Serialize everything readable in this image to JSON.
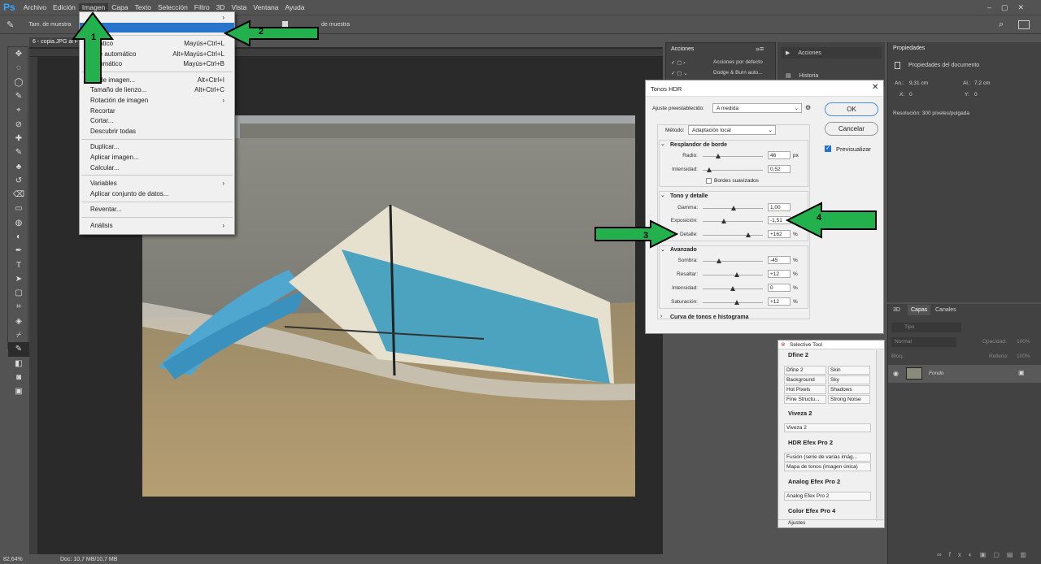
{
  "app": {
    "logo": "Ps"
  },
  "menubar": [
    "Archivo",
    "Edición",
    "Imagen",
    "Capa",
    "Texto",
    "Selección",
    "Filtro",
    "3D",
    "Vista",
    "Ventana",
    "Ayuda"
  ],
  "options": {
    "sample_size": "Tam. de muestra",
    "sample_label": "de muestra"
  },
  "doc": {
    "tab": "6 - copia.JPG al F",
    "zoom": "82,64%",
    "doc_size": "Doc: 10,7 MB/10,7 MB"
  },
  "image_menu": {
    "items": [
      {
        "label": "o",
        "shortcut": "",
        "sub": true,
        "state": "normal"
      },
      {
        "label": "",
        "shortcut": "",
        "sub": false,
        "state": "hl"
      },
      {
        "sep": true
      },
      {
        "label": "omático",
        "shortcut": "Mayús+Ctrl+L",
        "state": "normal"
      },
      {
        "label": "aste automático",
        "shortcut": "Alt+Mayús+Ctrl+L",
        "state": "normal"
      },
      {
        "label": "automático",
        "shortcut": "Mayús+Ctrl+B",
        "state": "normal"
      },
      {
        "sep": true
      },
      {
        "label": "ño de imagen...",
        "shortcut": "Alt+Ctrl+I",
        "state": "normal"
      },
      {
        "label": "Tamaño de lienzo...",
        "shortcut": "Alt+Ctrl+C",
        "state": "normal"
      },
      {
        "label": "Rotación de imagen",
        "shortcut": "",
        "sub": true,
        "state": "normal"
      },
      {
        "label": "Recortar",
        "shortcut": "",
        "state": "normal"
      },
      {
        "label": "Cortar...",
        "shortcut": "",
        "state": "normal"
      },
      {
        "label": "Descubrir todas",
        "shortcut": "",
        "state": "normal"
      },
      {
        "sep": true
      },
      {
        "label": "Duplicar...",
        "shortcut": "",
        "state": "normal"
      },
      {
        "label": "Aplicar imagen...",
        "shortcut": "",
        "state": "normal"
      },
      {
        "label": "Calcular...",
        "shortcut": "",
        "state": "normal"
      },
      {
        "sep": true
      },
      {
        "label": "Variables",
        "shortcut": "",
        "sub": true,
        "state": "normal"
      },
      {
        "label": "Aplicar conjunto de datos...",
        "shortcut": "",
        "state": "normal"
      },
      {
        "sep": true
      },
      {
        "label": "Reventar...",
        "shortcut": "",
        "state": "normal"
      },
      {
        "sep": true
      },
      {
        "label": "Análisis",
        "shortcut": "",
        "sub": true,
        "state": "normal"
      }
    ]
  },
  "actions": {
    "title": "Acciones",
    "rows": [
      "Acciones por defecto",
      "Dodge & Burn auto..."
    ]
  },
  "side": {
    "actions": "Acciones",
    "history": "Historia"
  },
  "props": {
    "title": "Propiedades",
    "doc_props": "Propiedades del documento",
    "an_label": "An.:",
    "an_val": "9,31 cm",
    "al_label": "Al.:",
    "al_val": "7,2 cm",
    "x_label": "X:",
    "x_val": "0",
    "y_label": "Y:",
    "y_val": "0",
    "resolution": "Resolución: 300 píxeles/pulgada"
  },
  "layers": {
    "tabs": [
      "3D",
      "Capas",
      "Canales"
    ],
    "search": "Tipo",
    "blend": "Normal",
    "opacity_label": "Opacidad:",
    "opacity": "100%",
    "lock_label": "Bloq.:",
    "fill_label": "Relleno:",
    "fill": "100%",
    "layer_name": "Fondo"
  },
  "hdr": {
    "title": "Tonos HDR",
    "preset_label": "Ajuste preestablecido:",
    "preset": "A medida",
    "method_label": "Método:",
    "method": "Adaptación local",
    "ok": "OK",
    "cancel": "Cancelar",
    "preview": "Previsualizar",
    "edge_title": "Resplandor de borde",
    "radius_label": "Radio:",
    "radius": "46",
    "radius_unit": "px",
    "strength_label": "Intensidad:",
    "strength": "0,52",
    "smooth": "Bordes suavizados",
    "tone_title": "Tono y detalle",
    "gamma_label": "Gamma:",
    "gamma": "1,00",
    "exposure_label": "Exposición:",
    "exposure": "-1,51",
    "detail_label": "Detalle:",
    "detail": "+162",
    "pct": "%",
    "adv_title": "Avanzado",
    "shadow_label": "Sombra:",
    "shadow": "-45",
    "highlight_label": "Resaltar:",
    "highlight": "+12",
    "vib_label": "Intensidad:",
    "vib": "0",
    "sat_label": "Saturación:",
    "sat": "+12",
    "curve_title": "Curva de tonos e histograma"
  },
  "selective": {
    "title": "Selective Tool",
    "dfine": "Dfine 2",
    "dfine_btns": [
      "Dfine 2",
      "Skin",
      "Background",
      "Sky",
      "Hot Pixels",
      "Shadows",
      "Fine Structu...",
      "Strong Noise"
    ],
    "viveza": "Viveza 2",
    "viveza_btn": "Viveza 2",
    "hdr": "HDR Efex Pro 2",
    "hdr_btns": [
      "Fusión (serie de varias imág...",
      "Mapa de tonos (imagen única)"
    ],
    "analog": "Analog Efex Pro 2",
    "analog_btn": "Analog Efex Pro 2",
    "color": "Color Efex Pro 4",
    "footer": "Ajustes"
  },
  "annotations": {
    "a1": "1",
    "a2": "2",
    "a3": "3",
    "a4": "4",
    "color": "#22b14c"
  }
}
